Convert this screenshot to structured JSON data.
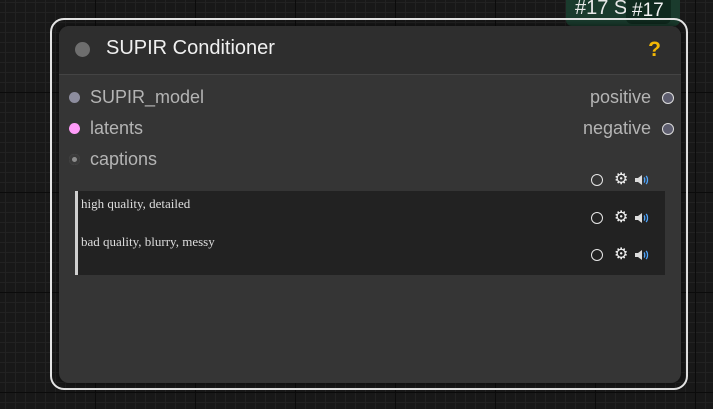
{
  "badge": {
    "back_label": "#17 S",
    "front_label": "#17"
  },
  "node": {
    "title": "SUPIR Conditioner",
    "help_label": "?",
    "inputs": [
      {
        "label": "SUPIR_model",
        "color": "#8d8d9e"
      },
      {
        "label": "latents",
        "color": "#ff9cf9"
      },
      {
        "label": "captions",
        "color": "#8d8d8d"
      }
    ],
    "outputs": [
      {
        "label": "positive",
        "color": "#5d5d6e"
      },
      {
        "label": "negative",
        "color": "#5d5d6e"
      }
    ],
    "widget": {
      "lines": [
        "high quality, detailed",
        "bad quality, blurry, messy"
      ]
    },
    "icons": [
      "circle-icon",
      "gear-icon",
      "speaker-icon"
    ]
  }
}
